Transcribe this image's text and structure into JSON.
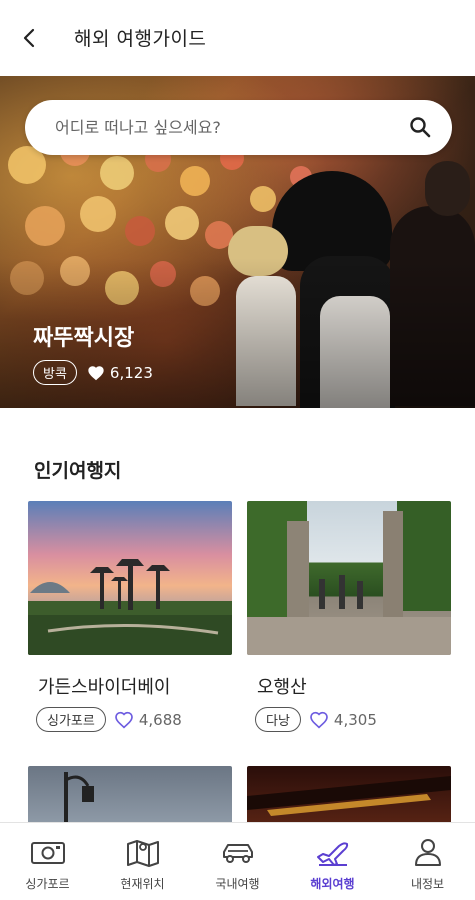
{
  "header": {
    "title": "해외 여행가이드",
    "back_icon": "chevron-left-icon"
  },
  "search": {
    "placeholder": "어디로 떠나고 싶으세요?",
    "icon": "search-icon"
  },
  "hero": {
    "title": "짜뚜짝시장",
    "tag": "방콕",
    "likes": "6,123",
    "heart_icon": "heart-filled-icon"
  },
  "popular": {
    "title": "인기여행지",
    "cards": [
      {
        "name": "가든스바이더베이",
        "tag": "싱가포르",
        "likes": "4,688"
      },
      {
        "name": "오행산",
        "tag": "다낭",
        "likes": "4,305"
      },
      {
        "name": "",
        "tag": "",
        "likes": ""
      },
      {
        "name": "",
        "tag": "",
        "likes": ""
      }
    ]
  },
  "nav": {
    "items": [
      {
        "label": "싱가포르",
        "icon": "camera-icon",
        "active": false
      },
      {
        "label": "현재위치",
        "icon": "map-icon",
        "active": false
      },
      {
        "label": "국내여행",
        "icon": "car-icon",
        "active": false
      },
      {
        "label": "해외여행",
        "icon": "airplane-icon",
        "active": true
      },
      {
        "label": "내정보",
        "icon": "person-icon",
        "active": false
      }
    ]
  },
  "colors": {
    "accent": "#5b3fd1",
    "like_heart": "#6d5ce0"
  }
}
